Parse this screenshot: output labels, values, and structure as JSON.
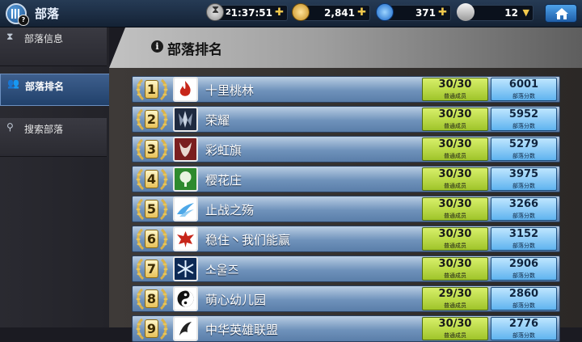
{
  "app": {
    "title": "部落"
  },
  "resources": {
    "timer_count": "2",
    "timer": "1:37:51",
    "gold": "2,841",
    "gems": "371",
    "trophies": "12"
  },
  "sidebar": {
    "items": [
      {
        "label": "部落信息",
        "icon": "hourglass-icon"
      },
      {
        "label": "部落排名",
        "icon": "group-icon"
      },
      {
        "label": "搜索部落",
        "icon": "search-icon"
      }
    ]
  },
  "panel": {
    "title": "部落排名"
  },
  "rows": [
    {
      "rank": "1",
      "name": "十里桃林",
      "members": "30/30",
      "members_label": "普通成员",
      "score": "6001",
      "score_label": "部落分数",
      "emblem_color": "#c02a1a"
    },
    {
      "rank": "2",
      "name": "荣耀",
      "members": "30/30",
      "members_label": "普通成员",
      "score": "5952",
      "score_label": "部落分数",
      "emblem_color": "#1a2740"
    },
    {
      "rank": "3",
      "name": "彩虹旗",
      "members": "30/30",
      "members_label": "普通成员",
      "score": "5279",
      "score_label": "部落分数",
      "emblem_color": "#7a1f1f"
    },
    {
      "rank": "4",
      "name": "樱花庄",
      "members": "30/30",
      "members_label": "普通成员",
      "score": "3975",
      "score_label": "部落分数",
      "emblem_color": "#2e8a2e"
    },
    {
      "rank": "5",
      "name": "止战之殇",
      "members": "30/30",
      "members_label": "普通成员",
      "score": "3266",
      "score_label": "部落分数",
      "emblem_color": "#ffffff"
    },
    {
      "rank": "6",
      "name": "稳住丶我们能赢",
      "members": "30/30",
      "members_label": "普通成员",
      "score": "3152",
      "score_label": "部落分数",
      "emblem_color": "#ffffff"
    },
    {
      "rank": "7",
      "name": "소울즈",
      "members": "30/30",
      "members_label": "普通成员",
      "score": "2906",
      "score_label": "部落分数",
      "emblem_color": "#0d2a55"
    },
    {
      "rank": "8",
      "name": "萌心幼儿园",
      "members": "29/30",
      "members_label": "普通成员",
      "score": "2860",
      "score_label": "部落分数",
      "emblem_color": "#ffffff"
    },
    {
      "rank": "9",
      "name": "中华英雄联盟",
      "members": "30/30",
      "members_label": "普通成员",
      "score": "2776",
      "score_label": "部落分数",
      "emblem_color": "#ffffff"
    }
  ]
}
